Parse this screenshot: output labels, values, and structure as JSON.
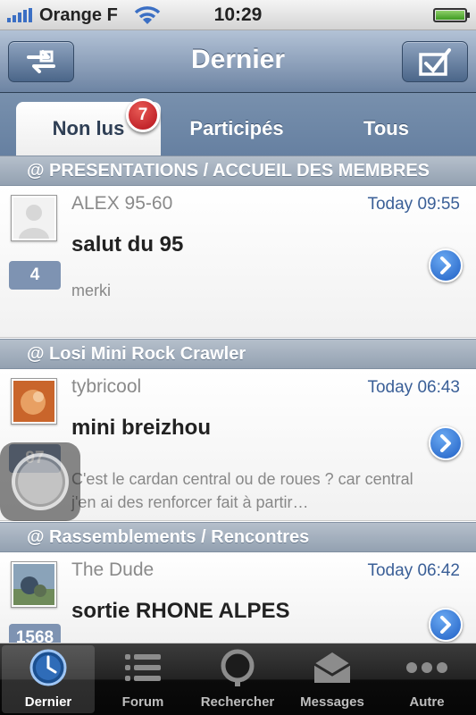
{
  "status_bar": {
    "carrier": "Orange F",
    "time": "10:29"
  },
  "nav": {
    "title": "Dernier",
    "left_icon": "refresh-swap-icon",
    "right_icon": "checkmark-icon"
  },
  "tabs": {
    "items": [
      {
        "label": "Non lus"
      },
      {
        "label": "Participés"
      },
      {
        "label": "Tous"
      }
    ],
    "badge": "7"
  },
  "sections": [
    {
      "header": "@ PRESENTATIONS / ACCUEIL DES MEMBRES",
      "topic": {
        "author": "ALEX 95-60",
        "time": "Today 09:55",
        "title": "salut du 95",
        "preview": "merki",
        "count": "4"
      }
    },
    {
      "header": "@ Losi Mini Rock Crawler",
      "topic": {
        "author": "tybricool",
        "time": "Today 06:43",
        "title": "mini breizhou",
        "preview": "C'est le cardan central ou de roues ? car central j'en ai des renforcer fait à partir…",
        "count": "97"
      }
    },
    {
      "header": "@ Rassemblements / Rencontres",
      "topic": {
        "author": "The Dude",
        "time": "Today 06:42",
        "title": "sortie RHONE ALPES",
        "preview": "",
        "count": "1568"
      }
    }
  ],
  "tabbar": {
    "items": [
      {
        "label": "Dernier",
        "icon": "clock-icon"
      },
      {
        "label": "Forum",
        "icon": "list-icon"
      },
      {
        "label": "Rechercher",
        "icon": "search-icon"
      },
      {
        "label": "Messages",
        "icon": "envelope-icon"
      },
      {
        "label": "Autre",
        "icon": "more-icon"
      }
    ]
  },
  "colors": {
    "nav": "#6d84a3",
    "badge": "#c3161f",
    "link_time": "#3a5f97",
    "count_box": "#7e93b2"
  }
}
